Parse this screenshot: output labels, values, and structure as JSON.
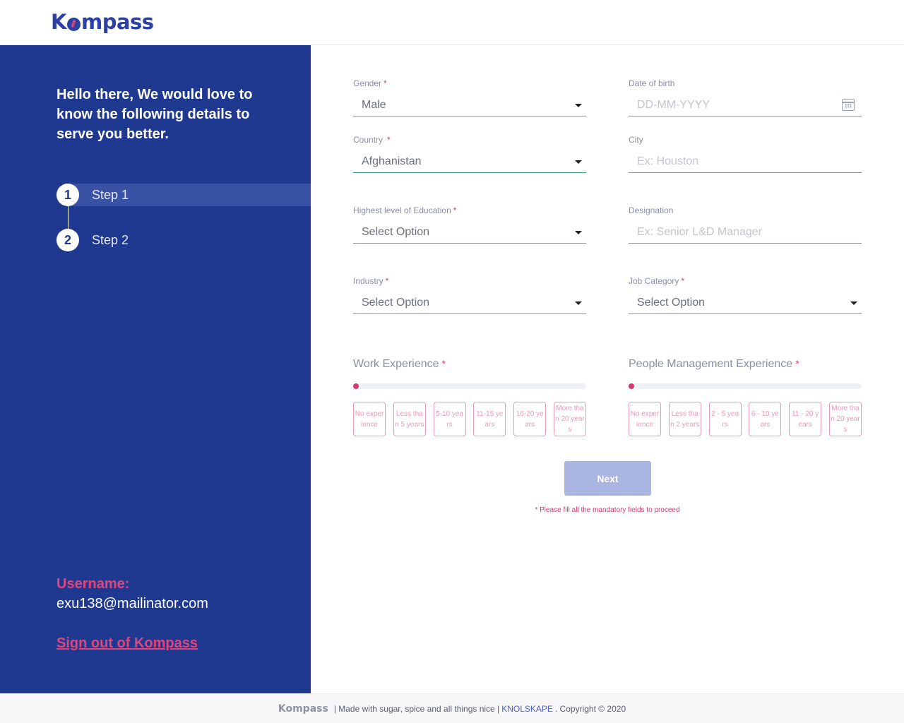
{
  "header": {
    "logo_text_pre": "K",
    "logo_text_post": "mpass"
  },
  "sidebar": {
    "intro": "Hello there, We would love to know the following details to serve you better.",
    "steps": [
      {
        "number": "1",
        "label": "Step 1"
      },
      {
        "number": "2",
        "label": "Step 2"
      }
    ],
    "username_label": "Username:",
    "username_value": "exu138@mailinator.com",
    "signout_label": "Sign out of Kompass"
  },
  "form": {
    "required_mark": "*",
    "gender": {
      "label": "Gender",
      "value": "Male"
    },
    "dob": {
      "label": "Date of birth",
      "placeholder": "DD-MM-YYYY"
    },
    "country": {
      "label": "Country",
      "value": "Afghanistan"
    },
    "city": {
      "label": "City",
      "placeholder": "Ex: Houston"
    },
    "education": {
      "label": "Highest level of Education",
      "value": "Select Option"
    },
    "designation": {
      "label": "Designation",
      "placeholder": "Ex: Senior L&D Manager"
    },
    "industry": {
      "label": "Industry",
      "value": "Select Option"
    },
    "job_category": {
      "label": "Job Category",
      "value": "Select Option"
    },
    "work_experience": {
      "title": "Work Experience",
      "level": 0,
      "options": [
        "No experience",
        "Less than 5 years",
        "5-10 years",
        "11-15 years",
        "16-20 years",
        "More than 20 years"
      ]
    },
    "people_experience": {
      "title": "People Management Experience",
      "level": 0,
      "options": [
        "No experience",
        "Less than 2 years",
        "2 - 5 years",
        "6 - 10 years",
        "11 - 20 years",
        "More than 20 years"
      ]
    },
    "next_label": "Next",
    "mandatory_note": "* Please fill all the mandatory fields to proceed"
  },
  "footer": {
    "logo_text": "Kompass",
    "tagline": "| Made with sugar, spice and all things nice |",
    "link": "KNOLSKAPE",
    "copyright": ". Copyright © 2020"
  },
  "colors": {
    "sidebar_bg": "#1f3890",
    "accent_pink": "#d23a6f",
    "brand_blue": "#2b3fa8",
    "button_disabled": "#a9b6e2"
  }
}
